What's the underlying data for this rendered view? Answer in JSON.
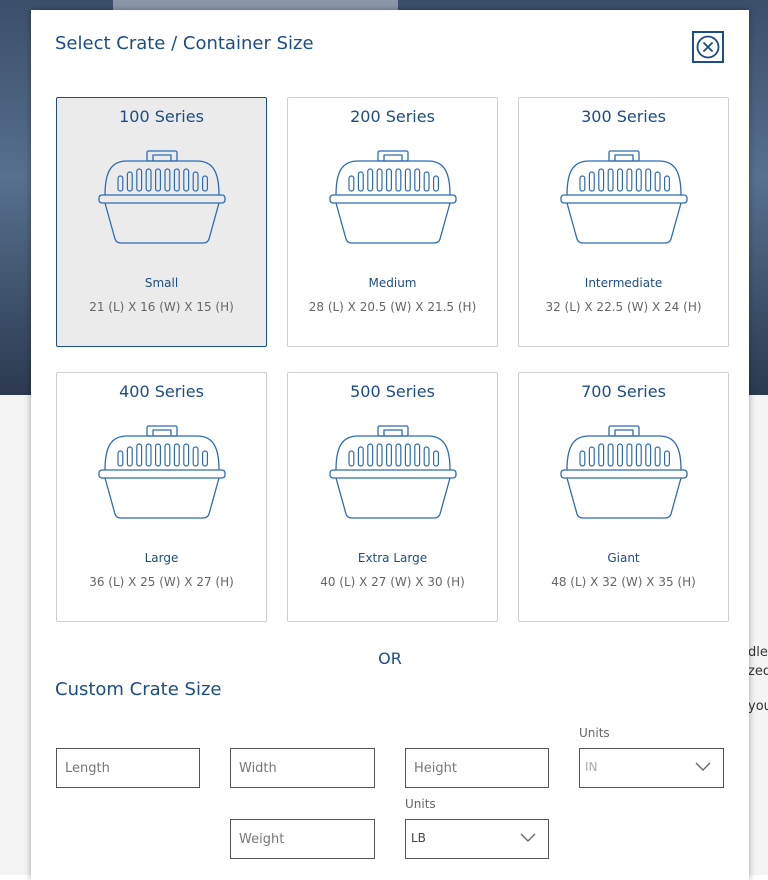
{
  "background": {
    "text_lines": [
      "dle",
      "zed",
      "you"
    ]
  },
  "modal": {
    "title": "Select Crate / Container Size",
    "close_icon": "close-circle-icon",
    "cards": [
      {
        "series": "100 Series",
        "size": "Small",
        "dims": "21 (L) X 16 (W) X 15 (H)",
        "selected": true,
        "icon": "pet-carrier-icon"
      },
      {
        "series": "200 Series",
        "size": "Medium",
        "dims": "28 (L) X 20.5 (W) X 21.5 (H)",
        "selected": false,
        "icon": "pet-carrier-icon"
      },
      {
        "series": "300 Series",
        "size": "Intermediate",
        "dims": "32 (L) X 22.5 (W) X 24 (H)",
        "selected": false,
        "icon": "pet-carrier-icon"
      },
      {
        "series": "400 Series",
        "size": "Large",
        "dims": "36 (L) X 25 (W) X 27 (H)",
        "selected": false,
        "icon": "pet-carrier-icon"
      },
      {
        "series": "500 Series",
        "size": "Extra Large",
        "dims": "40 (L) X 27 (W) X 30 (H)",
        "selected": false,
        "icon": "pet-carrier-icon"
      },
      {
        "series": "700 Series",
        "size": "Giant",
        "dims": "48 (L) X 32 (W) X 35 (H)",
        "selected": false,
        "icon": "pet-carrier-icon"
      }
    ],
    "or_label": "OR",
    "custom": {
      "title": "Custom Crate Size",
      "length_placeholder": "Length",
      "width_placeholder": "Width",
      "height_placeholder": "Height",
      "weight_placeholder": "Weight",
      "dim_units_label": "Units",
      "dim_units_value": "IN",
      "weight_units_label": "Units",
      "weight_units_value": "LB"
    }
  },
  "colors": {
    "accent": "#1d4d86",
    "selected_bg": "#ebebeb",
    "border": "#cfcfcf"
  }
}
